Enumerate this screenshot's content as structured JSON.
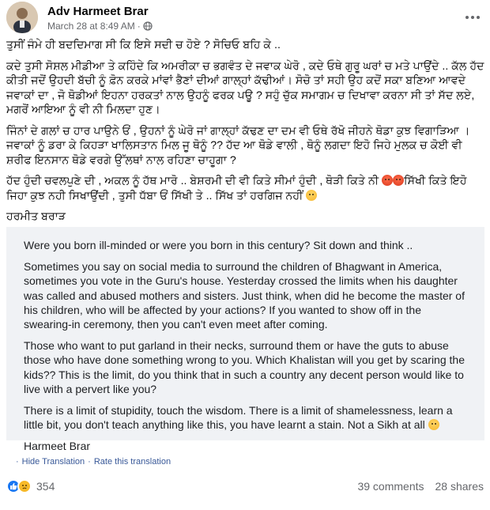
{
  "post": {
    "author": "Adv Harmeet Brar",
    "timestamp": "March 28 at 8:49 AM",
    "separator": "·"
  },
  "original": {
    "p1": "ਤੁਸੀਂ ਜੰਮੇ ਹੀ ਬਦਦਿਮਾਗ ਸੀ ਕਿ ਇਸੇ ਸਦੀ ਚ ਹੋਏ ? ਸੋਚਿਓ ਬਹਿ ਕੇ ..",
    "p2": "ਕਦੇ ਤੁਸੀ ਸੋਸ਼ਲ ਮੀਡੀਆ ਤੇ ਕਹਿੰਦੇ ਕਿ ਅਮਰੀਕਾ ਚ ਭਗਵੰਤ ਦੇ ਜਵਾਕ ਘੇਰੋ , ਕਦੇ ਓਥੇ ਗੁਰੂ ਘਰਾਂ ਚ ਮਤੇ ਪਾਉਂਦੇ .. ਕੱਲ ਹੱਦ ਕੀਤੀ ਜਦੋਂ ਉਹਦੀ ਬੱਚੀ ਨੂੰ ਫ਼ੋਨ ਕਰਕੇ ਮਾਂਵਾਂ ਭੈਣਾਂ ਦੀਆਂ ਗਾਲ੍ਹਾਂ ਕੱਢੀਆਂ। ਸੋਚੋ ਤਾਂ ਸਹੀ ਉਹ ਕਦੋਂ ਸਕਾ ਬਣਿਆ ਆਵਦੇ ਜਵਾਕਾਂ ਦਾ , ਜੋ ਥੋਡੀਆਂ ਇਹਨਾ ਹਰਕਤਾਂ ਨਾਲ ਉਹਨੂੰ ਫਰਕ ਪਊ ? ਸਹੁੰ ਚੁੱਕ ਸਮਾਗਮ ਚ ਦਿਖਾਵਾ ਕਰਨਾ ਸੀ ਤਾਂ ਸੱਦ ਲਏ, ਮਗਰੋਂ ਆਇਆ ਨੂੰ ਵੀ ਨੀ ਮਿਲਦਾ ਹੁਣ।",
    "p3": "ਜਿੰਨਾਂ ਦੇ ਗਲਾਂ ਚ ਹਾਰ ਪਾਉਨੇ ਓਂ , ਉਹਨਾਂ ਨੂੰ ਘੇਰੋ ਜਾਂ ਗਾਲ੍ਹਾਂ ਕੱਢਣ ਦਾ ਦਮ ਵੀ ਓਥੇ ਰੱਖੋ ਜੀਹਨੇ ਥੋਡਾ ਕੁਝ ਵਿਗਾੜਿਆ । ਜਵਾਕਾਂ ਨੂੰ ਡਰਾ ਕੇ ਕਿਹੜਾ ਖਾਲਿਸਤਾਨ ਮਿਲ ਜੂ ਥੋਨੂੰ ?? ਹੱਦ ਆ ਥੋਡੇ ਵਾਲੀ , ਥੋਨੂੰ ਲਗਦਾ ਇਹੋ ਜਿਹੇ ਮੁਲਕ ਚ ਕੋਈ ਵੀ ਸ਼ਰੀਫ ਇਨਸਾਨ ਥੋਡੇ ਵਰਗੇ ਉੱਲਥਾਂ ਨਾਲ ਰਹਿਣਾ ਚਾਹੂਗਾ ?",
    "p4": "ਹੱਦ ਹੁੰਦੀ ਚਵਲਪੁਣੇ ਦੀ , ਅਕਲ ਨੂੰ ਹੱਥ ਮਾਰੋ .. ਬੇਸ਼ਰਮੀ ਦੀ ਵੀ ਕਿਤੇ ਸੀਮਾਂ ਹੁੰਦੀ , ਥੋੜੀ ਕਿਤੇ ਨੀ",
    "p4b": "ਸਿੱਖੀ ਕਿਤੇ ਇਹੋ ਜਿਹਾ ਕੁਝ ਨਹੀ ਸਿਖਾਉਂਦੀ , ਤੁਸੀ ਧੱਬਾ ਓਂ ਸਿੱਖੀ ਤੇ .. ਸਿੱਖ ਤਾਂ ਹਰਗਿਜ ਨਹੀਂ",
    "signature": "ਹਰਮੀਤ ਬਰਾੜ"
  },
  "translation": {
    "p1": "Were you born ill-minded or were you born in this century? Sit down and think ..",
    "p2": "Sometimes you say on social media to surround the children of Bhagwant in America, sometimes you vote in the Guru's house. Yesterday crossed the limits when his daughter was called and abused mothers and sisters. Just think, when did he become the master of his children, who will be affected by your actions? If you wanted to show off in the swearing-in ceremony, then you can't even meet after coming.",
    "p3": "Those who want to put garland in their necks, surround them or have the guts to abuse those who have done something wrong to you. Which Khalistan will you get by scaring the kids?? This is the limit, do you think that in such a country any decent person would like to live with a pervert like you?",
    "p4": "There is a limit of stupidity, touch the wisdom. There is a limit of shamelessness, learn a little bit, you don't teach anything like this, you have learnt a stain. Not a Sikh at all",
    "signature": "Harmeet Brar",
    "hide_label": "Hide Translation",
    "rate_label": "Rate this translation",
    "dot": "·"
  },
  "footer": {
    "reaction_count": "354",
    "comments": "39 comments",
    "shares": "28 shares"
  },
  "icons": {
    "globe": "globe-icon",
    "more": "more-options-icon",
    "like": "like-reaction-icon",
    "sad": "sad-reaction-icon",
    "angry": "angry-emoji-icon"
  },
  "colors": {
    "link": "#385898",
    "like": "#1877f2",
    "sad": "#f7b928",
    "muted": "#65676b",
    "translation_bg": "#f0f2f5"
  }
}
